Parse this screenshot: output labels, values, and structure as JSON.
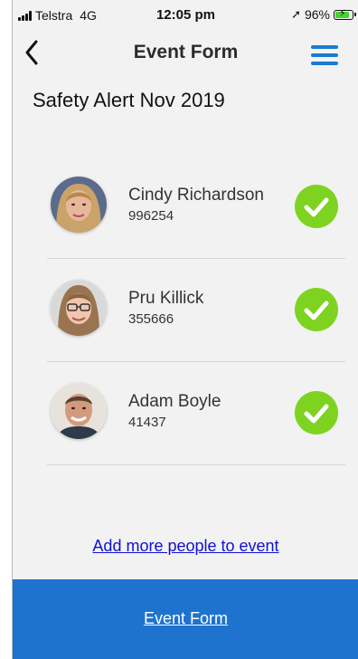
{
  "status_bar": {
    "carrier": "Telstra",
    "network": "4G",
    "time": "12:05 pm",
    "battery": "96%",
    "battery_level": 0.96,
    "icons": [
      "signal-icon",
      "location-arrow-icon",
      "battery-charging-icon"
    ]
  },
  "nav": {
    "title": "Event Form",
    "back_icon": "chevron-left-icon",
    "menu_icon": "hamburger-menu-icon"
  },
  "event": {
    "title": "Safety Alert Nov 2019"
  },
  "people": [
    {
      "name": "Cindy Richardson",
      "id": "996254",
      "checked": true
    },
    {
      "name": "Pru Killick",
      "id": "355666",
      "checked": true
    },
    {
      "name": "Adam Boyle",
      "id": "41437",
      "checked": true
    }
  ],
  "add_people_label": "Add more people to event",
  "bottom_bar": {
    "label": "Event Form"
  },
  "colors": {
    "accent_blue": "#1e73cf",
    "check_green": "#7ed321",
    "link_blue": "#1010d8"
  }
}
